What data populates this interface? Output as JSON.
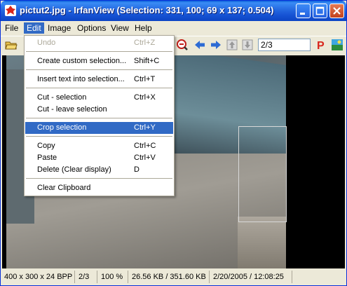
{
  "window": {
    "title": "pictut2.jpg - IrfanView (Selection: 331, 100; 69 x 137; 0.504)"
  },
  "menubar": {
    "items": [
      {
        "label": "File"
      },
      {
        "label": "Edit"
      },
      {
        "label": "Image"
      },
      {
        "label": "Options"
      },
      {
        "label": "View"
      },
      {
        "label": "Help"
      }
    ]
  },
  "toolbar": {
    "page_value": "2/3",
    "icons": [
      "open-folder-icon",
      "zoom-out-icon",
      "previous-arrow-icon",
      "next-arrow-icon",
      "first-page-icon",
      "last-page-icon",
      "paint-icon",
      "irfanview-logo-icon"
    ]
  },
  "edit_menu": {
    "items": [
      {
        "label": "Undo",
        "shortcut": "Ctrl+Z"
      },
      {
        "label": "Create custom selection...",
        "shortcut": "Shift+C"
      },
      {
        "label": "Insert text into selection...",
        "shortcut": "Ctrl+T"
      },
      {
        "label": "Cut - selection",
        "shortcut": "Ctrl+X"
      },
      {
        "label": "Cut - leave selection",
        "shortcut": ""
      },
      {
        "label": "Crop selection",
        "shortcut": "Ctrl+Y"
      },
      {
        "label": "Copy",
        "shortcut": "Ctrl+C"
      },
      {
        "label": "Paste",
        "shortcut": "Ctrl+V"
      },
      {
        "label": "Delete (Clear display)",
        "shortcut": "D"
      },
      {
        "label": "Clear Clipboard",
        "shortcut": ""
      }
    ]
  },
  "statusbar": {
    "dimensions": "400 x 300 x 24 BPP",
    "page": "2/3",
    "zoom": "100 %",
    "filesize": "26.56 KB / 351.60 KB",
    "datetime": "2/20/2005 / 12:08:25"
  },
  "colors": {
    "titlebar": "#2468E0",
    "highlight": "#316AC5",
    "face": "#ECE9D8"
  }
}
